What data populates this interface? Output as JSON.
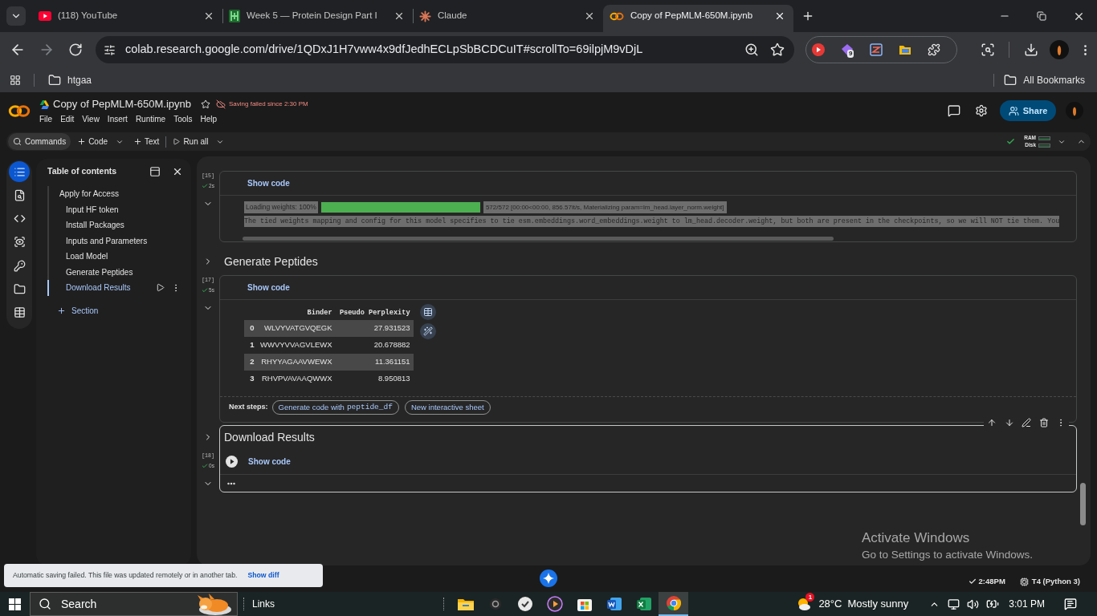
{
  "browser": {
    "tabs": [
      {
        "kind": "video",
        "title": "(118) YouTube",
        "selected": false
      },
      {
        "kind": "grid",
        "title": "Week 5 — Protein Design Part I",
        "selected": false
      },
      {
        "kind": "burst",
        "title": "Claude",
        "selected": false
      },
      {
        "kind": "rings",
        "title": "Copy of PepMLM-650M.ipynb",
        "selected": true
      }
    ],
    "url": "colab.research.google.com/drive/1QDxJ1H7vww4x9dfJedhECLpSbBCDCuIT#scrollTo=69ilpjM9vDjL",
    "extension_badge": "9",
    "bookmarks": [
      {
        "label": "htgaa"
      }
    ],
    "all_bookmarks": "All Bookmarks"
  },
  "colab": {
    "title": "Copy of PepMLM-650M.ipynb",
    "save_status": "Saving failed since 2:30 PM",
    "menu": [
      "File",
      "Edit",
      "View",
      "Insert",
      "Runtime",
      "Tools",
      "Help"
    ],
    "share": "Share",
    "toolbar": {
      "commands": "Commands",
      "code": "Code",
      "text": "Text",
      "run_all": "Run all",
      "ram": "RAM",
      "disk": "Disk"
    }
  },
  "sidebar": {
    "rail": [
      {
        "kind": "list",
        "selected": true
      },
      {
        "kind": "find",
        "selected": false
      },
      {
        "kind": "code",
        "selected": false
      },
      {
        "kind": "eye",
        "selected": false
      },
      {
        "kind": "key",
        "selected": false
      },
      {
        "kind": "folder",
        "selected": false
      },
      {
        "kind": "table",
        "selected": false
      }
    ]
  },
  "toc": {
    "title": "Table of contents",
    "items": [
      {
        "label": "Apply for Access",
        "selected": false,
        "children": [
          {
            "label": "Input HF token",
            "selected": false
          },
          {
            "label": "Install Packages",
            "selected": false
          },
          {
            "label": "Inputs and Parameters",
            "selected": false
          },
          {
            "label": "Load Model",
            "selected": false
          },
          {
            "label": "Generate Peptides",
            "selected": false
          },
          {
            "label": "Download Results",
            "selected": true
          }
        ]
      }
    ],
    "add_section": "Section"
  },
  "notebook": {
    "cells": [
      {
        "kind": "code",
        "selected": false,
        "count": "[15]",
        "time": "2s",
        "toggle": "Show code",
        "output": {
          "kind": "progress",
          "label": "Loading weights: 100%",
          "level": 1,
          "detail": "572/572 [00:00<00:00, 856.57it/s, Materializing param=lm_head.layer_norm.weight]",
          "log": "The tied weights mapping and config for this model specifies to tie esm.embeddings.word_embeddings.weight to lm_head.decoder.weight, but both are present in the checkpoints, so we will NOT tie them. You"
        }
      },
      {
        "kind": "heading",
        "selected": false,
        "title": "Generate Peptides"
      },
      {
        "kind": "code",
        "selected": false,
        "count": "[17]",
        "time": "5s",
        "toggle": "Show code",
        "output": {
          "kind": "dataframe",
          "columns": [
            "",
            "Binder",
            "Pseudo Perplexity"
          ],
          "rows": [
            [
              "0",
              "WLVYVATGVQEGK",
              "27.931523"
            ],
            [
              "1",
              "WWVYVVAGVLEWX",
              "20.678882"
            ],
            [
              "2",
              "RHYYAGAAVWEWX",
              "11.361151"
            ],
            [
              "3",
              "RHVPVAVAAQWWX",
              "8.950813"
            ]
          ],
          "next_steps": "Next steps:",
          "suggestions": [
            {
              "text": "Generate code with",
              "code": "peptide_df"
            },
            {
              "text": "New interactive sheet"
            }
          ]
        }
      },
      {
        "kind": "form",
        "selected": true,
        "title": "Download Results",
        "count": "[18]",
        "time": "0s",
        "toggle": "Show code"
      }
    ]
  },
  "toast": {
    "message": "Automatic saving failed. This file was updated remotely or in another tab.",
    "action": "Show diff"
  },
  "status_bar": {
    "saved": "2:48PM",
    "runtime": "T4 (Python 3)"
  },
  "activation": {
    "title": "Activate Windows",
    "subtitle": "Go to Settings to activate Windows."
  },
  "taskbar": {
    "search": {
      "placeholder": "Search"
    },
    "links": "Links",
    "apps": [
      {
        "kind": "files",
        "selected": false
      },
      {
        "kind": "ring",
        "selected": false
      },
      {
        "kind": "clock",
        "selected": false
      },
      {
        "kind": "media",
        "selected": false
      },
      {
        "kind": "store",
        "selected": false
      },
      {
        "kind": "document",
        "selected": false
      },
      {
        "kind": "sheet",
        "selected": false
      },
      {
        "kind": "browser",
        "selected": true
      }
    ],
    "weather": {
      "badge": "1",
      "temperature": "28°C",
      "condition": "Mostly sunny"
    },
    "time": "3:01 PM"
  }
}
